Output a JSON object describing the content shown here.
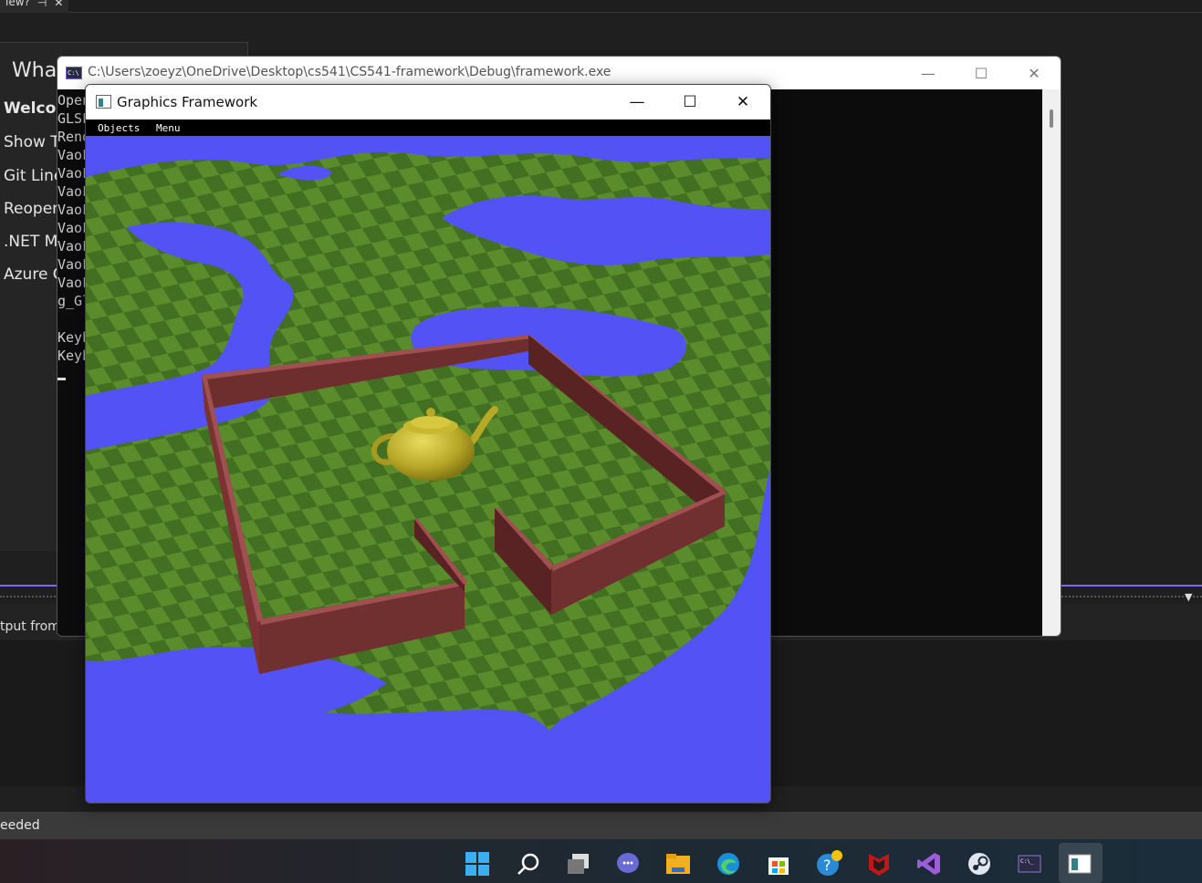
{
  "vs_background": {
    "tab": {
      "label": "iew?",
      "pin_glyph": "⊣",
      "close_glyph": "✕"
    },
    "start_panel": {
      "title": "What",
      "items": [
        "Welco",
        "Show T",
        "Git Line",
        "Reopen",
        ".NET M",
        "Azure C"
      ]
    },
    "output_label": "tput from",
    "status_text": "eeded"
  },
  "console_window": {
    "title": "C:\\Users\\zoeyz\\OneDrive\\Desktop\\cs541\\CS541-framework\\Debug\\framework.exe",
    "icon_text": "C:\\",
    "lines": [
      "Open",
      "GLSL",
      "Rend",
      "VaoF",
      "VaoF",
      "VaoF",
      "VaoF",
      "VaoF",
      "VaoF",
      "VaoF",
      "VaoF",
      "g_Gl",
      "",
      "Keyb",
      "Keyb"
    ],
    "buttons": {
      "minimize": "—",
      "maximize": "☐",
      "close": "✕"
    }
  },
  "graphics_window": {
    "title": "Graphics Framework",
    "menu": [
      "Objects",
      "Menu"
    ],
    "buttons": {
      "minimize": "—",
      "maximize": "☐",
      "close": "✕"
    },
    "scene": {
      "sky_water_color": "#5252f5",
      "grass_dark": "#3f6a1f",
      "grass_light": "#5a8a2a",
      "wall_top": "#9a4848",
      "wall_side": "#6b2a2a",
      "teapot_color": "#c8b830"
    }
  },
  "taskbar": {
    "icons": [
      "windows-start-icon",
      "search-icon",
      "task-view-icon",
      "teams-chat-icon",
      "file-explorer-icon",
      "edge-icon",
      "store-icon",
      "help-icon",
      "mcafee-icon",
      "visual-studio-icon",
      "steam-icon",
      "terminal-icon",
      "graphics-framework-icon"
    ]
  }
}
